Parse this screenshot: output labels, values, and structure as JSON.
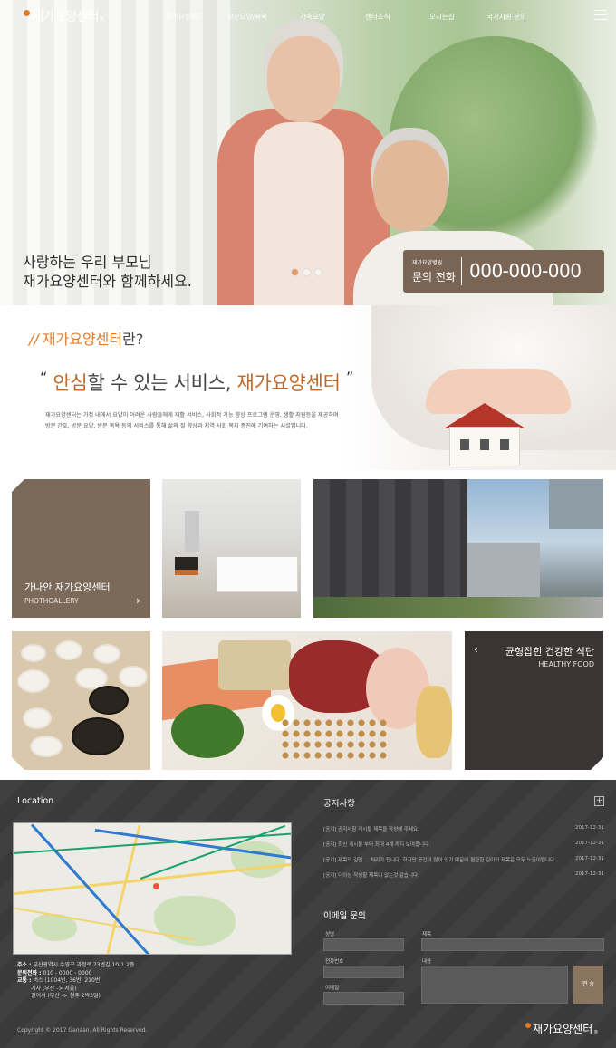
{
  "header": {
    "logo": "재가요양센터",
    "logo_tm": "®",
    "nav": [
      "장기요양제도",
      "방문요양/목욕",
      "가족요양",
      "센터소식",
      "오시는길",
      "국가지원 문의"
    ]
  },
  "hero": {
    "line1": "사랑하는 우리 부모님",
    "line2": "재가요양센터와 함께하세요.",
    "phone_small": "재가요양병원",
    "phone_label": "문의 전화",
    "phone_number": "000-000-000",
    "active_slide": 1,
    "slide_count": 3
  },
  "about": {
    "title_prefix": "//",
    "title_accent": "재가요양센터",
    "title_suffix": "란?",
    "quote_open": "“",
    "quote_accent1": "안심",
    "quote_middle": "할 수 있는 서비스,",
    "quote_accent2": "재가요양센터",
    "quote_close": "”",
    "desc1": "재가요양센터는 가정 내에서 요양이 어려운 사람들에게 재활 서비스, 사회적 기능 향상 프로그램 운영, 생활 지원등을 제공하며",
    "desc2": "방문 간호, 방문 요양, 방문 목욕 등의 서비스를 통해 삶의 질 향상과 지역 사회 복지 증진에 기여하는 시설입니다."
  },
  "gallery": {
    "title": "가나안 재가요양센터",
    "subtitle": "PHOTHGALLERY",
    "arrow": "›"
  },
  "food": {
    "title": "균형잡힌 건강한 식단",
    "subtitle": "HEALTHY FOOD",
    "arrow": "‹"
  },
  "footer": {
    "location_title": "Location",
    "addr_label": "주소 :",
    "addr": "부산광역시 수영구 과정로 73번길 10-1 2층",
    "tel_label": "문의전화 :",
    "tel": "010 - 0000 - 0000",
    "traffic_label": "교통 :",
    "traffic1": "버스 (1004번, 36번, 210번)",
    "traffic2": "기차 (부산 -> 서울)",
    "traffic3": "걸어서 (부산 -> 청주 2박3일)",
    "notice_title": "공지사항",
    "notice_plus": "+",
    "notices": [
      {
        "text": "[공지] 공지사항 게시물 제목을 작성해 주세요.",
        "date": "2017-12-31"
      },
      {
        "text": "[공지] 최신 게시물 부터 최대 4개 까지 보여줍니다.",
        "date": "2017-12-31"
      },
      {
        "text": "[공지] 제목의 길면 ... 처리가 됩니다. 하지만 공간이 많이 있기 때문에 편한한 길이의 제목은 모두 노출이됩니다. 하지만...",
        "date": "2017-12-31"
      },
      {
        "text": "[공지] 더이상 작성할 제목이 없는것 같습니다.",
        "date": "2017-12-31"
      }
    ],
    "email_title": "이메일 문의",
    "f_name": "성명",
    "f_subject": "제목",
    "f_phone": "전화번호",
    "f_content": "내용",
    "f_email": "이메일",
    "send": "전 송",
    "copyright": "Copyright © 2017 Ganaan. All Rights Reserved.",
    "logo": "재가요양센터",
    "logo_tm": "®"
  }
}
